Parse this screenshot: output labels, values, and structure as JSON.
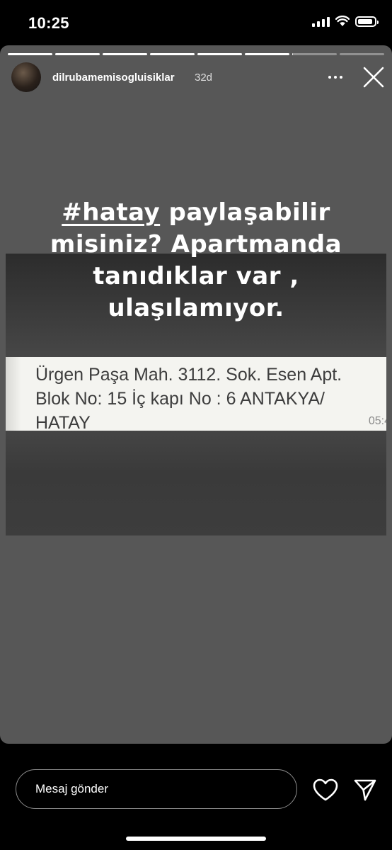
{
  "status_bar": {
    "time": "10:25",
    "signal_bars": 4,
    "wifi": true,
    "battery_level": 0.9
  },
  "story": {
    "progress": {
      "segment_count": 8,
      "active_index": 6,
      "active_fraction": 0.02
    },
    "author": {
      "username": "dilrubamemisogluisiklar",
      "time_ago": "32d",
      "avatar_icon": "profile-photo"
    },
    "caption": {
      "hashtag": "#hatay",
      "line1_rest": " paylaşabilir",
      "line2": "misiniz? Apartmanda",
      "line3": "tanıdıklar var ,",
      "line4": "ulaşılamıyor."
    },
    "screenshot_message": {
      "text": "Ürgen Paşa Mah. 3112. Sok. Esen Apt.\nBlok No: 15 İç kapı No : 6 ANTAKYA/\nHATAY",
      "time": "05:4"
    }
  },
  "bottom": {
    "message_placeholder": "Mesaj gönder",
    "like_icon": "heart-icon",
    "send_icon": "send-icon"
  },
  "colors": {
    "story_bg": "#575757",
    "screen_bg": "#000000",
    "bubble_bg": "#f4f4f0",
    "bubble_text": "#3d3d3d"
  }
}
